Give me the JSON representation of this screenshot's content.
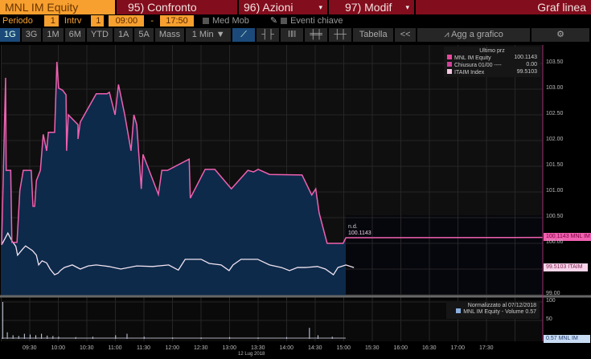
{
  "header": {
    "ticker": "MNL IM Equity",
    "compare": "95) Confronto",
    "actions": "96) Azioni",
    "modify": "97) Modif",
    "chart_type": "Graf linea",
    "dropdown": "▾"
  },
  "controls": {
    "period_label": "Periodo",
    "period_value": "1",
    "interval_label": "Intrv",
    "interval_value": "1",
    "start_time": "09:00",
    "dash": "-",
    "end_time": "17:50",
    "moving_avg": "Med Mob",
    "key_events": "Eventi chiave"
  },
  "toolbar": {
    "ranges": [
      "1G",
      "3G",
      "1M",
      "6M",
      "YTD",
      "1A",
      "5A",
      "Mass"
    ],
    "selected": "1G",
    "interval": "1 Min ▼",
    "table": "Tabella",
    "collapse": "<<",
    "add_to_chart": "Agg a grafico"
  },
  "legend": {
    "title": "Ultimo prz",
    "items": [
      {
        "label": "MNL IM Equity",
        "value": "100.1143",
        "color": "#e8489c"
      },
      {
        "label": "Chiusura 01/00 ----",
        "value": "0.00",
        "color": "#d0409a"
      },
      {
        "label": "ITAIM Index",
        "value": "99.5103",
        "color": "#f4c8e0"
      }
    ]
  },
  "volume_legend": {
    "title": "Normalizzato al 07/12/2018",
    "item": "MNL IM Equity - Volume 0.57"
  },
  "tags": {
    "price": "100.1143 MNL IM",
    "index": "99.5103 ITAIM",
    "volume": "0.57 MNL IM",
    "nd": "n.d.",
    "last": "100.1143"
  },
  "colors": {
    "price": "#f060b0",
    "index": "#f0e0f0",
    "fill": "#0d2a4a",
    "orange": "#f7a02f",
    "red": "#820d1c"
  },
  "chart_data": {
    "type": "line",
    "date_label": "12 Lug 2018",
    "xlim": [
      9.0,
      17.83
    ],
    "ylim": [
      99.0,
      103.8
    ],
    "x_ticks": [
      "09:30",
      "10:00",
      "10:30",
      "11:00",
      "11:30",
      "12:00",
      "12:30",
      "13:00",
      "13:30",
      "14:00",
      "14:30",
      "15:00",
      "15:30",
      "16:00",
      "16:30",
      "17:00",
      "17:30"
    ],
    "y_ticks": [
      "103.50",
      "103.00",
      "102.50",
      "102.00",
      "101.50",
      "101.00",
      "100.50",
      "100.00",
      "99.00"
    ],
    "series": [
      {
        "name": "MNL IM Equity",
        "x": [
          9.0,
          9.07,
          9.08,
          9.16,
          9.18,
          9.27,
          9.32,
          9.38,
          9.52,
          9.55,
          9.58,
          9.61,
          9.68,
          9.73,
          9.79,
          9.82,
          9.93,
          9.97,
          10.0,
          10.07,
          10.13,
          10.14,
          10.17,
          10.34,
          10.34,
          10.38,
          10.66,
          10.85,
          10.89,
          10.99,
          11.05,
          11.16,
          11.27,
          11.32,
          11.37,
          11.45,
          11.48,
          11.75,
          11.81,
          11.91,
          12.29,
          12.31,
          12.57,
          12.74,
          13.03,
          13.32,
          13.42,
          13.5,
          13.7,
          14.27,
          14.44,
          14.51,
          14.57,
          14.71,
          14.99,
          15.04
        ],
        "y": [
          99.97,
          103.22,
          101.42,
          101.42,
          100.02,
          100.02,
          101.03,
          101.42,
          101.42,
          100.72,
          100.72,
          101.22,
          101.42,
          102.12,
          101.8,
          102.16,
          102.16,
          103.53,
          103.02,
          102.98,
          102.89,
          101.8,
          102.5,
          102.31,
          102.03,
          102.36,
          102.91,
          102.91,
          102.94,
          102.5,
          103.09,
          102.5,
          101.8,
          102.5,
          102.31,
          101.06,
          101.73,
          100.95,
          101.42,
          101.42,
          101.64,
          100.88,
          101.44,
          101.44,
          101.06,
          101.42,
          101.39,
          101.44,
          101.34,
          101.33,
          100.94,
          101.06,
          100.59,
          100.0,
          100.0,
          100.11
        ]
      },
      {
        "name": "ITAIM Index",
        "x": [
          9.0,
          9.11,
          9.18,
          9.25,
          9.28,
          9.37,
          9.42,
          9.54,
          9.61,
          9.65,
          9.71,
          9.79,
          9.85,
          9.93,
          9.99,
          10.03,
          10.1,
          10.24,
          10.38,
          10.52,
          10.66,
          10.88,
          11.09,
          11.37,
          11.65,
          11.93,
          12.1,
          12.22,
          12.5,
          12.64,
          12.85,
          12.99,
          13.06,
          13.2,
          13.49,
          13.7,
          13.91,
          14.05,
          14.19,
          14.33,
          14.54,
          14.68,
          14.82,
          14.9,
          15.04,
          15.18
        ],
        "y": [
          99.97,
          100.2,
          100.05,
          99.94,
          99.77,
          99.89,
          99.95,
          99.86,
          99.77,
          99.58,
          99.66,
          99.62,
          99.5,
          99.39,
          99.42,
          99.47,
          99.53,
          99.58,
          99.5,
          99.56,
          99.58,
          99.55,
          99.5,
          99.56,
          99.55,
          99.58,
          99.48,
          99.69,
          99.69,
          99.61,
          99.58,
          99.47,
          99.58,
          99.69,
          99.69,
          99.58,
          99.53,
          99.47,
          99.53,
          99.53,
          99.55,
          99.5,
          99.39,
          99.53,
          99.58,
          99.53
        ]
      }
    ],
    "volume": {
      "name": "MNL IM Equity - Volume",
      "ylim": [
        0,
        100
      ],
      "y_ticks": [
        "100",
        "50"
      ],
      "x": [
        9.02,
        9.1,
        9.2,
        9.3,
        9.4,
        9.5,
        9.6,
        9.7,
        9.8,
        9.9,
        10.0,
        10.3,
        10.6,
        11.0,
        11.2,
        11.5,
        12.0,
        12.5,
        13.0,
        13.5,
        14.0,
        14.4,
        14.55,
        14.8
      ],
      "y": [
        100,
        18,
        10,
        8,
        14,
        12,
        10,
        14,
        9,
        8,
        6,
        5,
        6,
        10,
        14,
        6,
        4,
        4,
        5,
        4,
        5,
        30,
        10,
        6
      ]
    }
  }
}
